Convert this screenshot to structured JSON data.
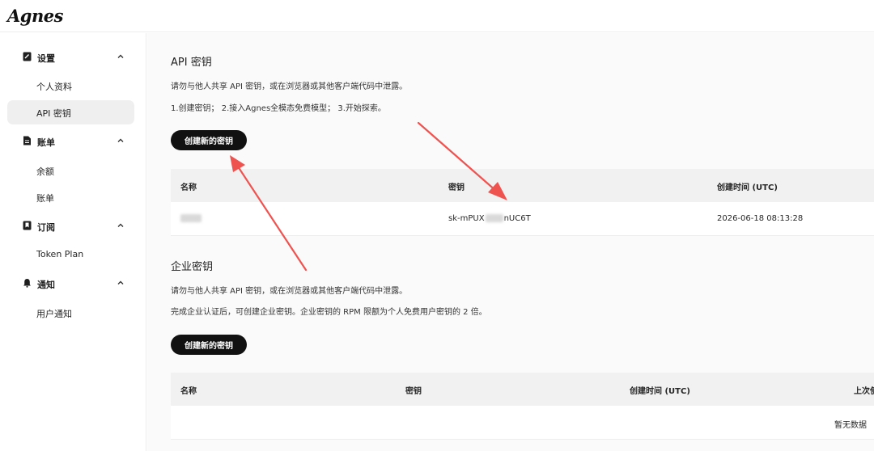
{
  "app": {
    "logo": "Agnes"
  },
  "sidebar": {
    "groups": [
      {
        "label": "设置",
        "icon": "settings-doc-icon",
        "items": [
          "个人资料",
          "API 密钥"
        ]
      },
      {
        "label": "账单",
        "icon": "bill-icon",
        "items": [
          "余额",
          "账单"
        ]
      },
      {
        "label": "订阅",
        "icon": "bookmark-icon",
        "items": [
          "Token Plan"
        ]
      },
      {
        "label": "通知",
        "icon": "bell-icon",
        "items": [
          "用户通知"
        ]
      }
    ],
    "active_item": "API 密钥"
  },
  "api_keys": {
    "title": "API 密钥",
    "desc1": "请勿与他人共享 API 密钥，或在浏览器或其他客户端代码中泄露。",
    "desc2": "1.创建密钥； 2.接入Agnes全模态免费模型； 3.开始探索。",
    "button": "创建新的密钥",
    "columns": [
      "名称",
      "密钥",
      "创建时间 (UTC)"
    ],
    "rows": [
      {
        "name": "",
        "key_prefix": "sk-mPUX",
        "key_suffix": "nUC6T",
        "created": "2026-06-18 08:13:28"
      }
    ]
  },
  "enterprise_keys": {
    "title": "企业密钥",
    "desc1": "请勿与他人共享 API 密钥，或在浏览器或其他客户端代码中泄露。",
    "desc2": "完成企业认证后，可创建企业密钥。企业密钥的 RPM 限额为个人免费用户密钥的 2 倍。",
    "button": "创建新的密钥",
    "columns": [
      "名称",
      "密钥",
      "创建时间 (UTC)",
      "上次使"
    ],
    "empty_text": "暂无数据"
  },
  "colors": {
    "accent": "#111111",
    "arrow": "#ef5350"
  }
}
